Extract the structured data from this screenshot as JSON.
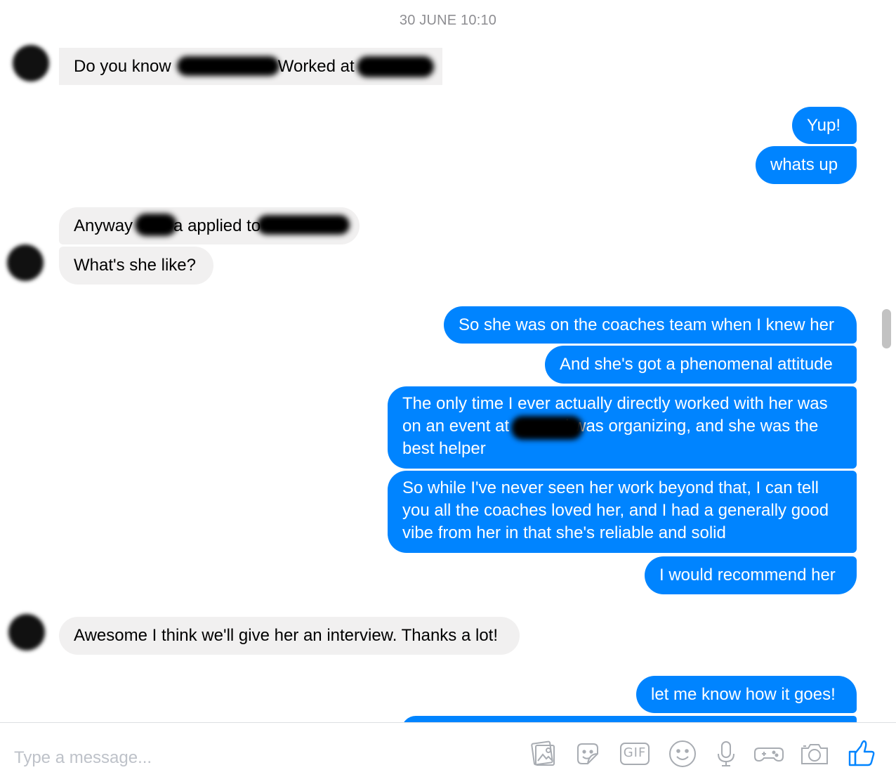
{
  "timestamp": "30 JUNE 10:10",
  "messages": {
    "m1": {
      "part1": "Do you know",
      "part2": "Worked at"
    },
    "m2": "Yup!",
    "m3": "whats up",
    "m4": {
      "part1": "Anyway",
      "part2": "a applied to"
    },
    "m5": "What's she like?",
    "m6": "So she was on the coaches team when I knew her",
    "m7": "And she's got a phenomenal attitude",
    "m8": {
      "part1": "The only time I ever actually directly worked with her was on an event at",
      "part2": "i was organizing, and she was the best helper"
    },
    "m9": "So while I've never seen her work beyond that, I can tell you all the coaches loved her, and I had a generally good vibe from her in that she's reliable and solid",
    "m10": "I would recommend her",
    "m11": "Awesome I think we'll give her an interview. Thanks a lot!",
    "m12": "let me know how it goes!"
  },
  "composer": {
    "placeholder": "Type a message...",
    "gif_label": "GIF",
    "icons": [
      "photo-icon",
      "sticker-icon",
      "gif-icon",
      "emoji-icon",
      "microphone-icon",
      "game-controller-icon",
      "camera-icon",
      "thumbs-up-icon"
    ]
  },
  "colors": {
    "outgoing_bubble": "#0084ff",
    "incoming_bubble": "#f1f0f0",
    "timestamp": "#8e8e92",
    "icon_gray": "#a8acb2",
    "like_blue": "#0084ff"
  }
}
